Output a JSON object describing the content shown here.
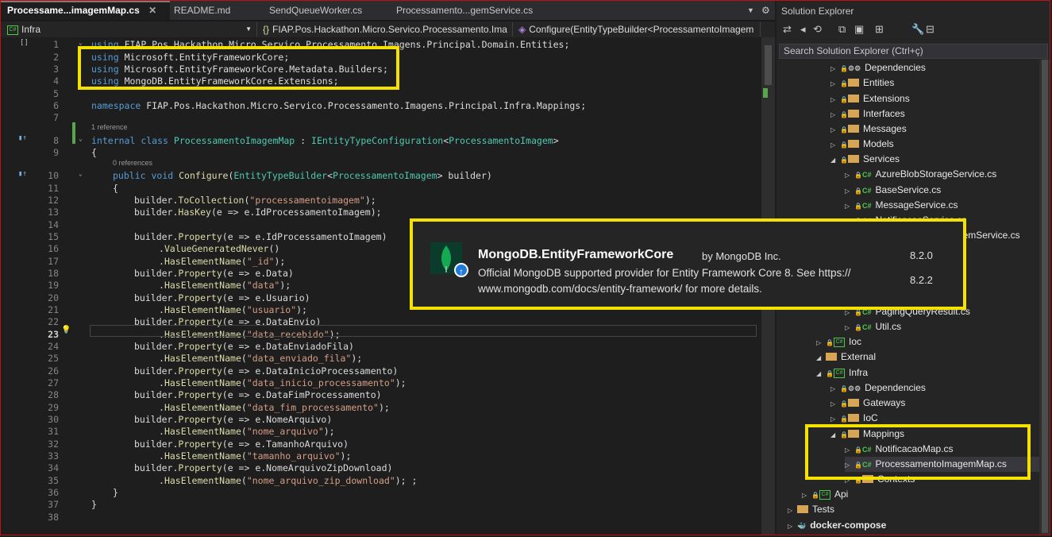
{
  "editor": {
    "tabs": [
      {
        "label": "Processame...imagemMap.cs",
        "active": true
      },
      {
        "label": "README.md"
      },
      {
        "label": "SendQueueWorker.cs"
      },
      {
        "label": "Processamento...gemService.cs"
      }
    ],
    "nav": {
      "project": "Infra",
      "namespace": "FIAP.Pos.Hackathon.Micro.Servico.Processamento.Ima",
      "member": "Configure(EntityTypeBuilder<ProcessamentoImagem"
    },
    "references_class": "1 reference",
    "references_method": "0 references",
    "lines": [
      {
        "n": "1",
        "segs": [
          [
            "kw",
            "using"
          ],
          [
            "",
            "FIAP.Pos.Hackathon.Micro.Servico.Processamento.Imagens.Principal.Domain.Entities;"
          ]
        ]
      },
      {
        "n": "2",
        "segs": [
          [
            "kw",
            "using"
          ],
          [
            "",
            "Microsoft.EntityFrameworkCore;"
          ]
        ]
      },
      {
        "n": "3",
        "segs": [
          [
            "kw",
            "using"
          ],
          [
            "",
            "Microsoft.EntityFrameworkCore.Metadata.Builders;"
          ]
        ]
      },
      {
        "n": "4",
        "segs": [
          [
            "kw",
            "using"
          ],
          [
            "",
            "MongoDB.EntityFrameworkCore.Extensions;"
          ]
        ]
      },
      {
        "n": "5",
        "segs": []
      },
      {
        "n": "6",
        "segs": [
          [
            "kw",
            "namespace"
          ],
          [
            "",
            "FIAP.Pos.Hackathon.Micro.Servico.Processamento.Imagens.Principal.Infra.Mappings;"
          ]
        ]
      },
      {
        "n": "7",
        "segs": []
      },
      {
        "n": "8",
        "segs": [
          [
            "kw",
            "internal"
          ],
          [
            "kw",
            "class"
          ],
          [
            "ty",
            "ProcessamentoImagemMap"
          ],
          [
            "",
            ": "
          ],
          [
            "ty",
            "IEntityTypeConfiguration"
          ],
          [
            "",
            "<"
          ],
          [
            "ty",
            "ProcessamentoImagem"
          ],
          [
            "",
            ">"
          ]
        ]
      },
      {
        "n": "9",
        "segs": [
          [
            "",
            "{"
          ]
        ]
      },
      {
        "n": "10",
        "segs": [
          [
            "kw",
            "public"
          ],
          [
            "kw",
            "void"
          ],
          [
            "mth",
            "Configure"
          ],
          [
            "",
            "("
          ],
          [
            "ty",
            "EntityTypeBuilder"
          ],
          [
            "",
            "<"
          ],
          [
            "ty",
            "ProcessamentoImagem"
          ],
          [
            "",
            "> builder)"
          ]
        ]
      },
      {
        "n": "11",
        "segs": [
          [
            "",
            "{"
          ]
        ]
      },
      {
        "n": "12",
        "segs": [
          [
            "",
            "builder."
          ],
          [
            "mth",
            "ToCollection"
          ],
          [
            "",
            "("
          ],
          [
            "str",
            "\"processamentoimagem\""
          ],
          [
            "",
            ");"
          ]
        ]
      },
      {
        "n": "13",
        "segs": [
          [
            "",
            "builder."
          ],
          [
            "mth",
            "HasKey"
          ],
          [
            "",
            "(e => e.IdProcessamentoImagem);"
          ]
        ]
      },
      {
        "n": "14",
        "segs": []
      },
      {
        "n": "15",
        "segs": [
          [
            "",
            "builder."
          ],
          [
            "mth",
            "Property"
          ],
          [
            "",
            "(e => e.IdProcessamentoImagem)"
          ]
        ]
      },
      {
        "n": "16",
        "segs": [
          [
            "",
            "."
          ],
          [
            "mth",
            "ValueGeneratedNever"
          ],
          [
            "",
            "()"
          ]
        ]
      },
      {
        "n": "17",
        "segs": [
          [
            "",
            "."
          ],
          [
            "mth",
            "HasElementName"
          ],
          [
            "",
            "("
          ],
          [
            "str",
            "\"_id\""
          ],
          [
            "",
            ");"
          ]
        ]
      },
      {
        "n": "18",
        "segs": [
          [
            "",
            "builder."
          ],
          [
            "mth",
            "Property"
          ],
          [
            "",
            "(e => e.Data)"
          ]
        ]
      },
      {
        "n": "19",
        "segs": [
          [
            "",
            "."
          ],
          [
            "mth",
            "HasElementName"
          ],
          [
            "",
            "("
          ],
          [
            "str",
            "\"data\""
          ],
          [
            "",
            ");"
          ]
        ]
      },
      {
        "n": "20",
        "segs": [
          [
            "",
            "builder."
          ],
          [
            "mth",
            "Property"
          ],
          [
            "",
            "(e => e.Usuario)"
          ]
        ]
      },
      {
        "n": "21",
        "segs": [
          [
            "",
            "."
          ],
          [
            "mth",
            "HasElementName"
          ],
          [
            "",
            "("
          ],
          [
            "str",
            "\"usuario\""
          ],
          [
            "",
            ");"
          ]
        ]
      },
      {
        "n": "22",
        "segs": [
          [
            "",
            "builder."
          ],
          [
            "mth",
            "Property"
          ],
          [
            "",
            "(e => e.DataEnvio)"
          ]
        ]
      },
      {
        "n": "23",
        "segs": [
          [
            "",
            "."
          ],
          [
            "mth",
            "HasElementName"
          ],
          [
            "",
            "("
          ],
          [
            "str",
            "\"data_recebido\""
          ],
          [
            "",
            ");"
          ]
        ]
      },
      {
        "n": "24",
        "segs": [
          [
            "",
            "builder."
          ],
          [
            "mth",
            "Property"
          ],
          [
            "",
            "(e => e.DataEnviadoFila)"
          ]
        ]
      },
      {
        "n": "25",
        "segs": [
          [
            "",
            "."
          ],
          [
            "mth",
            "HasElementName"
          ],
          [
            "",
            "("
          ],
          [
            "str",
            "\"data_enviado_fila\""
          ],
          [
            "",
            ");"
          ]
        ]
      },
      {
        "n": "26",
        "segs": [
          [
            "",
            "builder."
          ],
          [
            "mth",
            "Property"
          ],
          [
            "",
            "(e => e.DataInicioProcessamento)"
          ]
        ]
      },
      {
        "n": "27",
        "segs": [
          [
            "",
            "."
          ],
          [
            "mth",
            "HasElementName"
          ],
          [
            "",
            "("
          ],
          [
            "str",
            "\"data_inicio_processamento\""
          ],
          [
            "",
            ");"
          ]
        ]
      },
      {
        "n": "28",
        "segs": [
          [
            "",
            "builder."
          ],
          [
            "mth",
            "Property"
          ],
          [
            "",
            "(e => e.DataFimProcessamento)"
          ]
        ]
      },
      {
        "n": "29",
        "segs": [
          [
            "",
            "."
          ],
          [
            "mth",
            "HasElementName"
          ],
          [
            "",
            "("
          ],
          [
            "str",
            "\"data_fim_processamento\""
          ],
          [
            "",
            ");"
          ]
        ]
      },
      {
        "n": "30",
        "segs": [
          [
            "",
            "builder."
          ],
          [
            "mth",
            "Property"
          ],
          [
            "",
            "(e => e.NomeArquivo)"
          ]
        ]
      },
      {
        "n": "31",
        "segs": [
          [
            "",
            "."
          ],
          [
            "mth",
            "HasElementName"
          ],
          [
            "",
            "("
          ],
          [
            "str",
            "\"nome_arquivo\""
          ],
          [
            "",
            ");"
          ]
        ]
      },
      {
        "n": "32",
        "segs": [
          [
            "",
            "builder."
          ],
          [
            "mth",
            "Property"
          ],
          [
            "",
            "(e => e.TamanhoArquivo)"
          ]
        ]
      },
      {
        "n": "33",
        "segs": [
          [
            "",
            "."
          ],
          [
            "mth",
            "HasElementName"
          ],
          [
            "",
            "("
          ],
          [
            "str",
            "\"tamanho_arquivo\""
          ],
          [
            "",
            ");"
          ]
        ]
      },
      {
        "n": "34",
        "segs": [
          [
            "",
            "builder."
          ],
          [
            "mth",
            "Property"
          ],
          [
            "",
            "(e => e.NomeArquivoZipDownload)"
          ]
        ]
      },
      {
        "n": "35",
        "segs": [
          [
            "",
            "."
          ],
          [
            "mth",
            "HasElementName"
          ],
          [
            "",
            "("
          ],
          [
            "str",
            "\"nome_arquivo_zip_download\""
          ],
          [
            "",
            "); ;"
          ]
        ]
      },
      {
        "n": "36",
        "segs": [
          [
            "",
            "}"
          ]
        ]
      },
      {
        "n": "37",
        "segs": [
          [
            "",
            "}"
          ]
        ]
      },
      {
        "n": "38",
        "segs": []
      }
    ]
  },
  "tooltip": {
    "package_name": "MongoDB.EntityFrameworkCore",
    "author": "by MongoDB Inc.",
    "description": "Official MongoDB supported provider for Entity Framework Core 8. See https:// www.mongodb.com/docs/entity-framework/ for more details.",
    "installed_version": "8.2.0",
    "latest_version": "8.2.2"
  },
  "solution_explorer": {
    "title": "Solution Explorer",
    "search_placeholder": "Search Solution Explorer (Ctrl+ç)",
    "items": [
      {
        "label": "Dependencies",
        "kind": "deps"
      },
      {
        "label": "Entities",
        "kind": "folder"
      },
      {
        "label": "Extensions",
        "kind": "folder"
      },
      {
        "label": "Interfaces",
        "kind": "folder"
      },
      {
        "label": "Messages",
        "kind": "folder"
      },
      {
        "label": "Models",
        "kind": "folder"
      },
      {
        "label": "Services",
        "kind": "folder"
      },
      {
        "label": "AzureBlobStorageService.cs",
        "kind": "cs"
      },
      {
        "label": "BaseService.cs",
        "kind": "cs"
      },
      {
        "label": "MessageService.cs",
        "kind": "cs"
      },
      {
        "label": "NotificacaoService.cs",
        "kind": "cs"
      },
      {
        "label": "ProcessamentoImagemService.cs",
        "kind": "cs"
      },
      {
        "label": "PagingQueryResult.cs",
        "kind": "cs"
      },
      {
        "label": "Util.cs",
        "kind": "cs"
      },
      {
        "label": "Ioc",
        "kind": "proj"
      },
      {
        "label": "External",
        "kind": "folder"
      },
      {
        "label": "Infra",
        "kind": "proj"
      },
      {
        "label": "Dependencies",
        "kind": "deps"
      },
      {
        "label": "Gateways",
        "kind": "folder"
      },
      {
        "label": "IoC",
        "kind": "folder"
      },
      {
        "label": "Mappings",
        "kind": "folder"
      },
      {
        "label": "NotificacaoMap.cs",
        "kind": "cs"
      },
      {
        "label": "ProcessamentoImagemMap.cs",
        "kind": "cs"
      },
      {
        "label": "Contexts",
        "kind": "folder"
      },
      {
        "label": "Api",
        "kind": "proj"
      },
      {
        "label": "Tests",
        "kind": "folder"
      },
      {
        "label": "docker-compose",
        "kind": "docker"
      }
    ]
  },
  "colors": {
    "highlight": "#f5e100",
    "editor_bg": "#1e1e1e",
    "keyword": "#569cd6",
    "type": "#4ec9b0",
    "string": "#d69d85",
    "method": "#dcdcaa"
  }
}
